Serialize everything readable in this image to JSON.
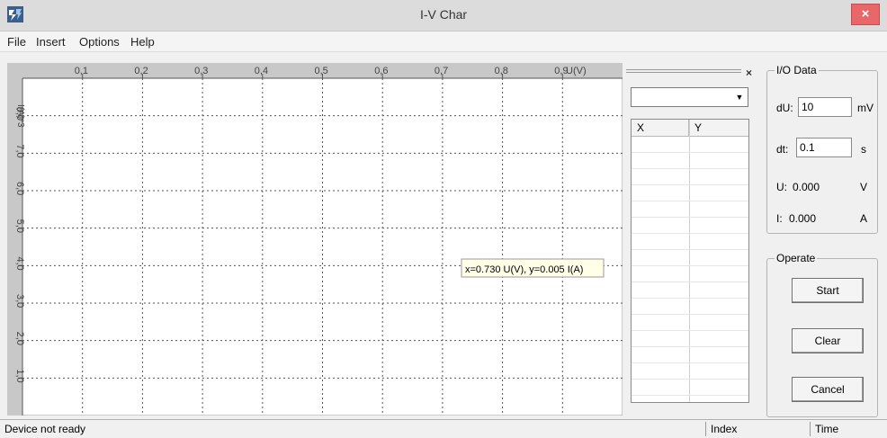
{
  "window": {
    "title": "I-V Char",
    "close_label": "×"
  },
  "menu": {
    "items": [
      "File",
      "Insert",
      "Options",
      "Help"
    ]
  },
  "chart_data": {
    "type": "line",
    "x_ticks": [
      "0,1",
      "0,2",
      "0,3",
      "0,4",
      "0,5",
      "0,6",
      "0,7",
      "0,8",
      "0,9"
    ],
    "x_unit": "U(V)",
    "y_ticks": [
      "1,0",
      "2,0",
      "3,0",
      "4,0",
      "5,0",
      "6,0",
      "7,0",
      "8,0"
    ],
    "y_top_label": "I(A)*3",
    "xlim": [
      0.0,
      1.0
    ],
    "ylim": [
      0.0,
      9.0
    ],
    "grid": true,
    "series": [],
    "cursor_readout": "x=0.730 U(V), y=0.005 I(A)"
  },
  "list_panel": {
    "close_label": "×",
    "combo_value": "",
    "columns": [
      "X",
      "Y"
    ]
  },
  "io_data": {
    "title": "I/O Data",
    "du_label": "dU:",
    "du_value": "10",
    "du_unit": "mV",
    "dt_label": "dt:",
    "dt_value": "0.1",
    "dt_unit": "s",
    "u_label": "U:",
    "u_value": "0.000",
    "u_unit": "V",
    "i_label": "I:",
    "i_value": "0.000",
    "i_unit": "A"
  },
  "operate": {
    "title": "Operate",
    "start_label": "Start",
    "clear_label": "Clear",
    "cancel_label": "Cancel"
  },
  "status": {
    "message": "Device not ready",
    "index_label": "Index",
    "time_label": "Time"
  }
}
